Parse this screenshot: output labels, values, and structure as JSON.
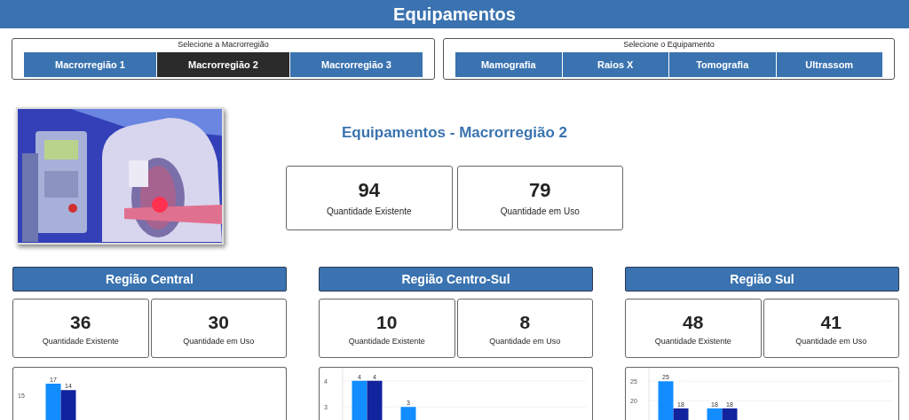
{
  "header": {
    "title": "Equipamentos"
  },
  "macro_selector": {
    "label": "Selecione a Macrorregião",
    "options": [
      {
        "label": "Macrorregião 1",
        "selected": false
      },
      {
        "label": "Macrorregião 2",
        "selected": true
      },
      {
        "label": "Macrorregião 3",
        "selected": false
      }
    ]
  },
  "equipment_selector": {
    "label": "Selecione o Equipamento",
    "options": [
      {
        "label": "Mamografia",
        "selected": false
      },
      {
        "label": "Raios X",
        "selected": false
      },
      {
        "label": "Tomografia",
        "selected": false
      },
      {
        "label": "Ultrassom",
        "selected": false
      }
    ]
  },
  "summary": {
    "title": "Equipamentos - Macrorregião 2",
    "kpis": [
      {
        "value": "94",
        "label": "Quantidade Existente"
      },
      {
        "value": "79",
        "label": "Quantidade em Uso"
      }
    ]
  },
  "regions": [
    {
      "title": "Região Central",
      "kpis": [
        {
          "value": "36",
          "label": "Quantidade Existente"
        },
        {
          "value": "30",
          "label": "Quantidade em Uso"
        }
      ],
      "chart_data": {
        "type": "bar",
        "categories": [
          null
        ],
        "annotations": [
          "15"
        ],
        "data_labels": true,
        "series": [
          {
            "color": "#118dff",
            "values": [
              17
            ]
          },
          {
            "color": "#12239e",
            "values": [
              14
            ]
          }
        ]
      }
    },
    {
      "title": "Região Centro-Sul",
      "kpis": [
        {
          "value": "10",
          "label": "Quantidade Existente"
        },
        {
          "value": "8",
          "label": "Quantidade em Uso"
        }
      ],
      "chart_data": {
        "type": "bar",
        "ylim": [
          2.5,
          4.5
        ],
        "yticks": [
          3,
          4
        ],
        "data_labels": true,
        "series": [
          {
            "color": "#118dff",
            "values": [
              4,
              3,
              null,
              null,
              null
            ]
          },
          {
            "color": "#12239e",
            "values": [
              4,
              null,
              null,
              null,
              null
            ]
          }
        ]
      }
    },
    {
      "title": "Região Sul",
      "kpis": [
        {
          "value": "48",
          "label": "Quantidade Existente"
        },
        {
          "value": "41",
          "label": "Quantidade em Uso"
        }
      ],
      "chart_data": {
        "type": "bar",
        "ylim": [
          15,
          28.5
        ],
        "yticks": [
          20,
          25
        ],
        "data_labels": true,
        "series": [
          {
            "color": "#118dff",
            "values": [
              25,
              18,
              null,
              null,
              null
            ]
          },
          {
            "color": "#12239e",
            "values": [
              18,
              18,
              null,
              null,
              null
            ]
          }
        ]
      }
    }
  ]
}
